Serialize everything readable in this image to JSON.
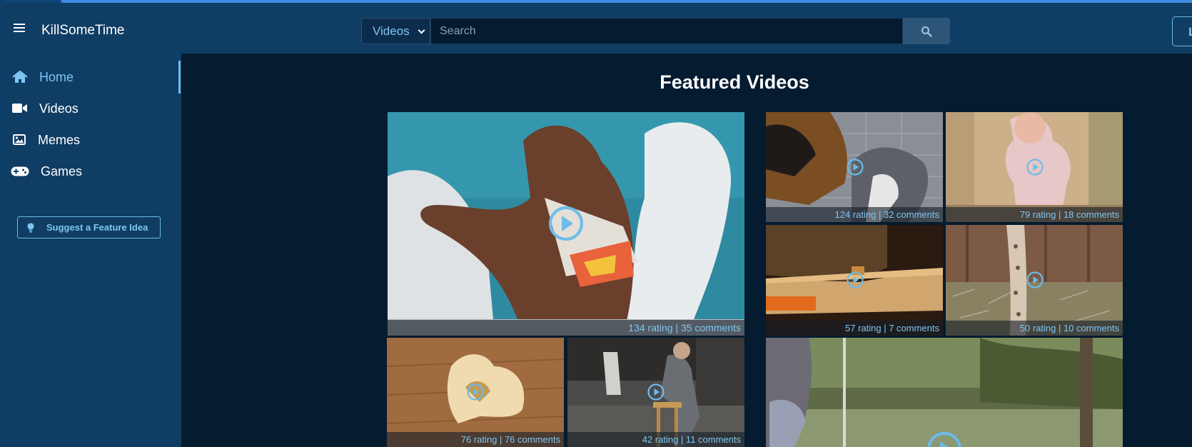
{
  "header": {
    "brand": "KillSomeTime",
    "search_category": "Videos",
    "search_placeholder": "Search",
    "login_label": "L"
  },
  "sidebar": {
    "items": [
      {
        "label": "Home",
        "icon": "home-icon",
        "active": true
      },
      {
        "label": "Videos",
        "icon": "video-camera-icon",
        "active": false
      },
      {
        "label": "Memes",
        "icon": "image-icon",
        "active": false
      },
      {
        "label": "Games",
        "icon": "gamepad-icon",
        "active": false
      }
    ],
    "suggest_label": "Suggest a Feature Idea"
  },
  "main": {
    "title": "Featured Videos",
    "videos": [
      {
        "meta": "134 rating | 35 comments"
      },
      {
        "meta": "124 rating | 32 comments"
      },
      {
        "meta": "79 rating | 18 comments"
      },
      {
        "meta": "57 rating | 7 comments"
      },
      {
        "meta": "50 rating | 10 comments"
      },
      {
        "meta": "76 rating | 76 comments"
      },
      {
        "meta": "42 rating | 11 comments"
      },
      {
        "meta": ""
      }
    ]
  },
  "colors": {
    "accent": "#7ec6f2",
    "header_bg": "#0f3d64",
    "page_bg": "#041b30"
  }
}
